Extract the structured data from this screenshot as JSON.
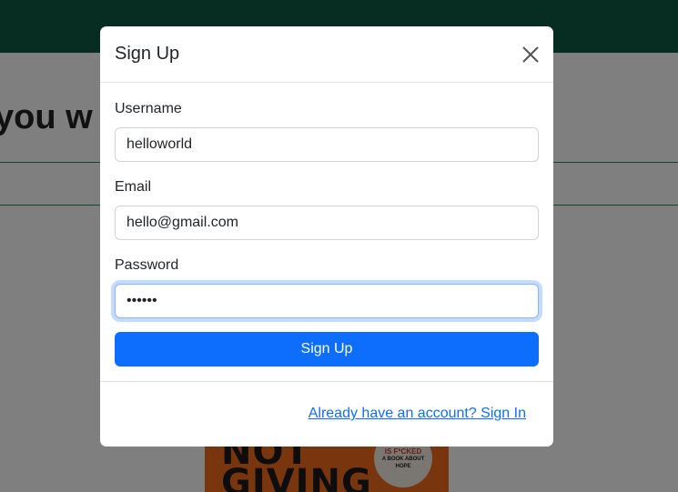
{
  "background": {
    "nav_color": "#0f5a46",
    "heading_fragment": "you w",
    "book": {
      "title_fragment": "NOT\nGIVING",
      "badge_line1": "IS F*CKED",
      "badge_line2": "A BOOK ABOUT",
      "badge_line3": "HOPE"
    }
  },
  "modal": {
    "title": "Sign Up",
    "close_icon": "close-icon",
    "fields": {
      "username": {
        "label": "Username",
        "value": "helloworld"
      },
      "email": {
        "label": "Email",
        "value": "hello@gmail.com"
      },
      "password": {
        "label": "Password",
        "value": "••••••"
      }
    },
    "submit_label": "Sign Up",
    "footer_link": "Already have an account? Sign In"
  },
  "colors": {
    "primary": "#0d6efd",
    "focus_ring": "#86b7fe"
  }
}
